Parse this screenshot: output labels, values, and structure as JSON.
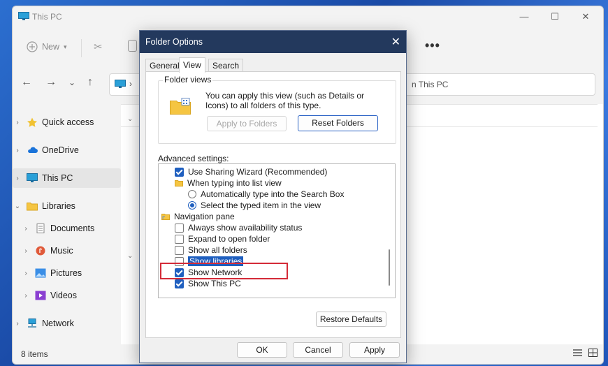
{
  "explorer": {
    "title": "This PC",
    "window_controls": {
      "minimize": "—",
      "maximize": "☐",
      "close": "✕"
    },
    "toolbar": {
      "new_label": "New",
      "more_label": "•••"
    },
    "nav": {
      "back": "←",
      "forward": "→",
      "recent": "⌄",
      "up": "↑"
    },
    "address_sep": "›",
    "search_path": "n This PC",
    "sidebar": [
      {
        "label": "Quick access",
        "icon": "star-icon"
      },
      {
        "label": "OneDrive",
        "icon": "cloud-icon"
      },
      {
        "label": "This PC",
        "icon": "monitor-icon",
        "selected": true
      },
      {
        "label": "Libraries",
        "icon": "folder-icon"
      },
      {
        "label": "Documents",
        "icon": "documents-icon"
      },
      {
        "label": "Music",
        "icon": "music-icon"
      },
      {
        "label": "Pictures",
        "icon": "pictures-icon"
      },
      {
        "label": "Videos",
        "icon": "videos-icon"
      },
      {
        "label": "Network",
        "icon": "network-icon"
      }
    ],
    "status": "8 items"
  },
  "dialog": {
    "title": "Folder Options",
    "close_label": "✕",
    "tabs": [
      "General",
      "View",
      "Search"
    ],
    "active_tab": "View",
    "folder_views": {
      "legend": "Folder views",
      "description": "You can apply this view (such as Details or Icons) to all folders of this type.",
      "apply_button": "Apply to Folders",
      "reset_button": "Reset Folders"
    },
    "advanced_label": "Advanced settings:",
    "advanced_items": [
      {
        "type": "checkbox",
        "checked": true,
        "label": "Use Sharing Wizard (Recommended)"
      },
      {
        "type": "folder",
        "label": "When typing into list view"
      },
      {
        "type": "radio",
        "checked": false,
        "label": "Automatically type into the Search Box"
      },
      {
        "type": "radio",
        "checked": true,
        "label": "Select the typed item in the view"
      },
      {
        "type": "folder",
        "label": "Navigation pane"
      },
      {
        "type": "checkbox",
        "checked": false,
        "label": "Always show availability status"
      },
      {
        "type": "checkbox",
        "checked": false,
        "label": "Expand to open folder"
      },
      {
        "type": "checkbox",
        "checked": false,
        "label": "Show all folders"
      },
      {
        "type": "checkbox",
        "checked": false,
        "label": "Show libraries",
        "selected": true
      },
      {
        "type": "checkbox",
        "checked": true,
        "label": "Show Network"
      },
      {
        "type": "checkbox",
        "checked": true,
        "label": "Show This PC"
      }
    ],
    "restore_button": "Restore Defaults",
    "ok_button": "OK",
    "cancel_button": "Cancel",
    "apply_button": "Apply"
  },
  "colors": {
    "accent": "#1f5fbf",
    "dialog_titlebar": "#23395d",
    "highlight": "#d42b38"
  }
}
